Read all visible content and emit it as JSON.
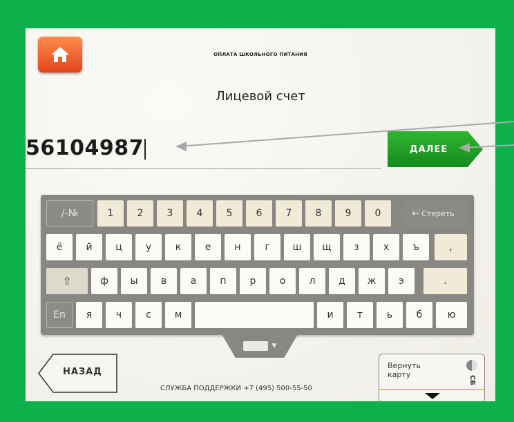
{
  "header": {
    "service_title": "ОПЛАТА ШКОЛЬНОГО ПИТАНИЯ",
    "subtitle": "Лицевой счет"
  },
  "account": {
    "value": "56104987"
  },
  "next_button": {
    "label": "ДАЛЕЕ"
  },
  "keyboard": {
    "row1": [
      "/-№",
      "1",
      "2",
      "3",
      "4",
      "5",
      "6",
      "7",
      "8",
      "9",
      "0"
    ],
    "backspace_label": "Стереть",
    "row2": [
      "ё",
      "й",
      "ц",
      "у",
      "к",
      "е",
      "н",
      "г",
      "ш",
      "щ",
      "з",
      "х",
      "ъ",
      ","
    ],
    "row3": [
      "ф",
      "ы",
      "в",
      "а",
      "п",
      "р",
      "о",
      "л",
      "д",
      "ж",
      "э",
      "."
    ],
    "row4_lang": "En",
    "row4_left": [
      "я",
      "ч",
      "с",
      "м"
    ],
    "row4_right": [
      "и",
      "т",
      "ь",
      "б",
      "ю"
    ]
  },
  "footer": {
    "back_label": "НАЗАД",
    "support_text": "СЛУЖБА ПОДДЕРЖКИ +7 (495) 500-55-50",
    "return_card_label": "Вернуть карту",
    "card_brand": "СБ"
  },
  "icons": {
    "home": "home-icon",
    "backspace": "arrow-left-icon",
    "shift": "shift-icon",
    "keyboard_toggle": "keyboard-icon"
  },
  "colors": {
    "frame": "#0db14b",
    "home_button": "#f0592a",
    "next_button": "#1f9e2a"
  }
}
